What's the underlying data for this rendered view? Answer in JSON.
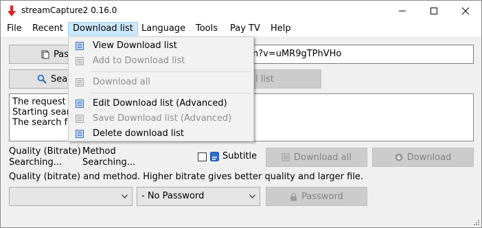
{
  "window": {
    "title": "streamCapture2 0.16.0"
  },
  "menubar": {
    "items": [
      {
        "label": "File"
      },
      {
        "label": "Recent"
      },
      {
        "label": "Download list"
      },
      {
        "label": "Language"
      },
      {
        "label": "Tools"
      },
      {
        "label": "Pay TV"
      },
      {
        "label": "Help"
      }
    ]
  },
  "download_menu": {
    "items": [
      {
        "label": "View Download list",
        "enabled": true,
        "icon": "list-icon"
      },
      {
        "label": "Add to Download list",
        "enabled": false,
        "icon": "list-icon"
      },
      {
        "label": "Download all",
        "enabled": false,
        "icon": "list-icon"
      },
      {
        "label": "Edit Download list (Advanced)",
        "enabled": true,
        "icon": "list-icon"
      },
      {
        "label": "Save Download list (Advanced)",
        "enabled": false,
        "icon": "list-icon"
      },
      {
        "label": "Delete download list",
        "enabled": true,
        "icon": "list-icon"
      }
    ]
  },
  "toolbar": {
    "paste_label": "Pas",
    "url_value": "n?v=uMR9gTPhVHo",
    "search_label": "Sea",
    "add_list_label": "l list"
  },
  "log": {
    "lines": [
      "The request",
      "Starting sear",
      "The search fa"
    ]
  },
  "info": {
    "quality_header": "Quality (Bitrate)",
    "quality_value": "Searching...",
    "method_header": "Method",
    "method_value": "Searching...",
    "subtitle_label": "Subtitle",
    "download_all_label": "Download all",
    "download_label": "Download",
    "hint": "Quality (bitrate) and method. Higher bitrate gives better quality and larger file."
  },
  "bottom": {
    "quality_select_value": "",
    "password_select_value": "- No Password",
    "password_button_label": "Password"
  },
  "colors": {
    "accent": "#cce8ff",
    "menu_icon_blue": "#2f6fd0",
    "app_icon_red": "#e02020"
  }
}
